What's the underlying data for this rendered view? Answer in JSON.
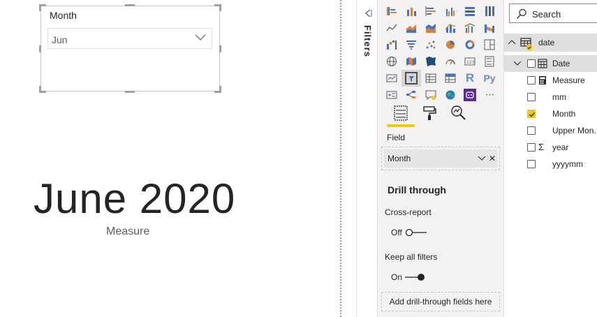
{
  "slicer": {
    "title": "Month",
    "selected_value": "Jun"
  },
  "card": {
    "value": "June 2020",
    "label": "Measure"
  },
  "filters_pane": {
    "label": "Filters"
  },
  "visualizations": {
    "field_section_label": "Field",
    "field_well_value": "Month",
    "field_remove_glyph": "✕",
    "drill_through": {
      "title": "Drill through",
      "cross_report_label": "Cross-report",
      "cross_report_state": "Off",
      "keep_filters_label": "Keep all filters",
      "keep_filters_state": "On",
      "add_fields_label": "Add drill-through fields here"
    },
    "r_visual_glyph": "R",
    "py_visual_glyph": "Py",
    "more_glyph": "···"
  },
  "fields": {
    "search_placeholder": "Search",
    "table_name": "date",
    "items": [
      {
        "label": "Date",
        "type_glyph": "",
        "checked": false
      },
      {
        "label": "Measure",
        "type_glyph": "",
        "checked": false
      },
      {
        "label": "mm",
        "type_glyph": "",
        "checked": false
      },
      {
        "label": "Month",
        "type_glyph": "",
        "checked": true
      },
      {
        "label": "Upper Mon...",
        "type_glyph": "",
        "checked": false
      },
      {
        "label": "year",
        "type_glyph": "Σ",
        "checked": false
      },
      {
        "label": "yyyymm",
        "type_glyph": "",
        "checked": false
      }
    ]
  },
  "colors": {
    "accent": "#f2c811",
    "pane_bg": "#f3f2f1",
    "text": "#252423"
  }
}
